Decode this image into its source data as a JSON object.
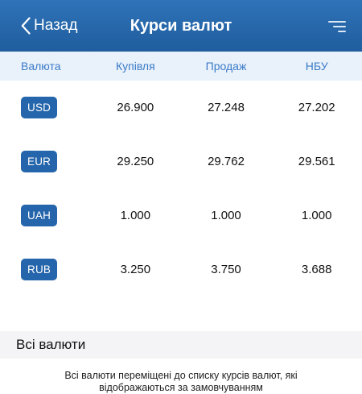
{
  "nav": {
    "back_label": "Назад",
    "title": "Курси валют",
    "menu_icon": "sort-lines-icon"
  },
  "table": {
    "headers": [
      "Валюта",
      "Купівля",
      "Продаж",
      "НБУ"
    ],
    "rows": [
      {
        "code": "USD",
        "buy": "26.900",
        "sell": "27.248",
        "nbu": "27.202"
      },
      {
        "code": "EUR",
        "buy": "29.250",
        "sell": "29.762",
        "nbu": "29.561"
      },
      {
        "code": "UAH",
        "buy": "1.000",
        "sell": "1.000",
        "nbu": "1.000"
      },
      {
        "code": "RUB",
        "buy": "3.250",
        "sell": "3.750",
        "nbu": "3.688"
      }
    ]
  },
  "all_currencies": {
    "title": "Всі валюти",
    "note": "Всі валюти переміщені до списку курсів валют, які відображаються за замовчуванням"
  },
  "colors": {
    "nav_top": "#2f73b8",
    "nav_bottom": "#1f5d9e",
    "header_bg": "#e9f1fa",
    "header_text": "#3a7bc8",
    "badge": "#2465ab"
  }
}
